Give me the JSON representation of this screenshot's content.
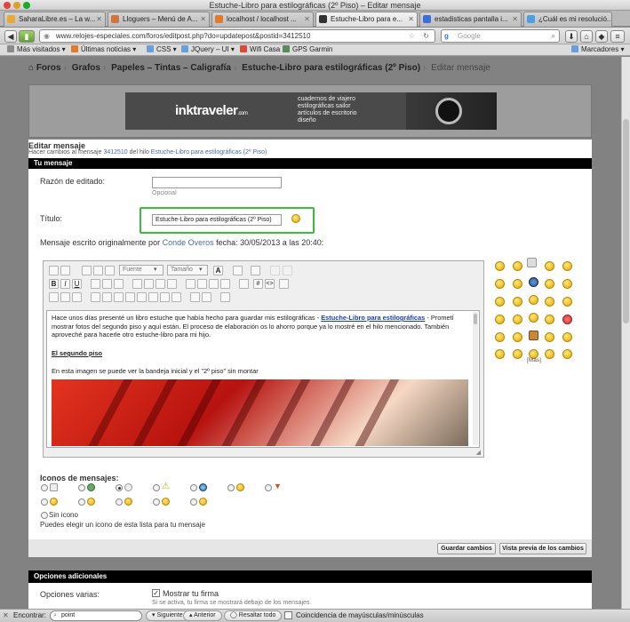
{
  "window": {
    "title": "Estuche-Libro para estilográficas (2º Piso) – Editar mensaje"
  },
  "tabs": [
    {
      "label": "SaharaLibre.es – La w...",
      "color": "#e8a83a",
      "active": false
    },
    {
      "label": "Lloguers – Menú de A...",
      "color": "#d0743a",
      "active": false
    },
    {
      "label": "localhost / localhost ...",
      "color": "#e07a2e",
      "active": false
    },
    {
      "label": "Estuche-Libro para e...",
      "color": "#333333",
      "active": true
    },
    {
      "label": "estadisticas pantalla i...",
      "color": "#3a6fd8",
      "active": false
    },
    {
      "label": "¿Cuál es mi resolució...",
      "color": "#4aa0e0",
      "active": false
    }
  ],
  "nav": {
    "url": "www.relojes-especiales.com/foros/editpost.php?do=updatepost&postid=3412510",
    "search_placeholder": "Google"
  },
  "bookmarks": [
    {
      "label": "Más visitados ▾",
      "color": "#8a8a8a"
    },
    {
      "label": "Últimas noticias ▾",
      "color": "#e07a2e"
    },
    {
      "label": "CSS ▾",
      "color": "#6aa0d8"
    },
    {
      "label": "JQuery – UI ▾",
      "color": "#6aa0d8"
    },
    {
      "label": "Wifi Casa",
      "color": "#d84a3a"
    },
    {
      "label": "GPS Garmin",
      "color": "#5a8a5a"
    },
    {
      "label": "Marcadores ▾",
      "color": "#6aa0d8"
    }
  ],
  "breadcrumb": [
    "Foros",
    "Grafos",
    "Papeles – Tintas – Caligrafía",
    "Estuche-Libro para estilográficas (2º Piso)",
    "Editar mensaje"
  ],
  "banner": {
    "logo": "inktraveler",
    "logo_suffix": ".com",
    "lines": [
      "cuadernos de viajero",
      "estilográficas sailor",
      "artículos de escritorio",
      "diseño"
    ]
  },
  "edit": {
    "title": "Editar mensaje",
    "sub_prefix": "Hacer cambios al mensaje",
    "post_id": "3412510",
    "sub_mid": "del hilo",
    "thread": "Estuche-Libro para estilográficas (2º Piso)"
  },
  "form": {
    "section_title": "Tu mensaje",
    "razon_label": "Razón de editado:",
    "razon_value": "",
    "razon_hint": "Opcional",
    "titulo_label": "Título:",
    "titulo_value": "Estuche-Libro para estilográficas (2º Piso)",
    "orig_prefix": "Mensaje escrito originalmente por",
    "orig_author": "Conde Overos",
    "orig_suffix": "fecha: 30/05/2013 a las 20:40:"
  },
  "editor": {
    "font_select": "Fuente",
    "size_select": "Tamaño",
    "p1_start": "Hace unos días presenté un libro estuche que había hecho para guardar mis estilográficas - ",
    "p1_link": "Estuche-Libro para estilográficas",
    "p1_end": " - Prometí mostrar fotos del segundo piso y aquí están. El proceso de elaboración os lo ahorro porque ya lo mostré en el hilo mencionado. También aproveché para hacerle otro estuche-libro para mi hijo.",
    "heading": "El segundo piso",
    "p2": "En esta imagen se puede ver la bandeja inicial y el \"2º piso\" sin montar"
  },
  "smilies": {
    "more": "[Más]"
  },
  "icons": {
    "title": "Iconos de mensajes:",
    "none_label": "Sin icono",
    "help": "Puedes elegir un icono de esta lista para tu mensaje"
  },
  "buttons": {
    "save": "Guardar cambios",
    "preview": "Vista previa de los cambios"
  },
  "options": {
    "title": "Opciones adicionales",
    "varias_label": "Opciones varias:",
    "firma_label": "Mostrar tu firma",
    "firma_hint": "Si se activa, tu firma se mostrará debajo de los mensajes."
  },
  "findbar": {
    "label": "Encontrar:",
    "value": "point",
    "next": "Siguiente",
    "prev": "Anterior",
    "highlight": "Resaltar todo",
    "match_case": "Coincidencia de mayúsculas/minúsculas"
  }
}
